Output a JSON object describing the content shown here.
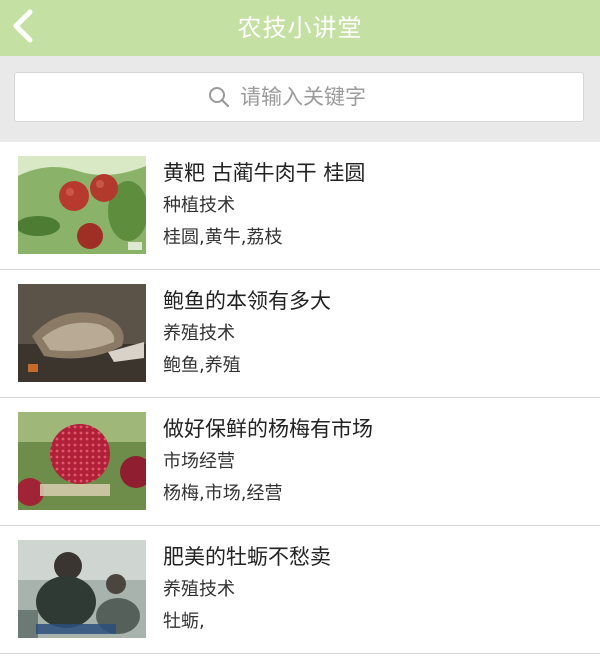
{
  "header": {
    "title": "农技小讲堂"
  },
  "search": {
    "placeholder": "请输入关键字"
  },
  "items": [
    {
      "title": "黄粑 古蔺牛肉干 桂圆",
      "category": "种植技术",
      "tags": "桂圆,黄牛,荔枝",
      "thumb": "longan-thumbnail"
    },
    {
      "title": "鲍鱼的本领有多大",
      "category": "养殖技术",
      "tags": "鲍鱼,养殖",
      "thumb": "abalone-thumbnail"
    },
    {
      "title": "做好保鲜的杨梅有市场",
      "category": "市场经营",
      "tags": "杨梅,市场,经营",
      "thumb": "bayberry-thumbnail"
    },
    {
      "title": "肥美的牡蛎不愁卖",
      "category": "养殖技术",
      "tags": "牡蛎,",
      "thumb": "oyster-thumbnail"
    }
  ]
}
